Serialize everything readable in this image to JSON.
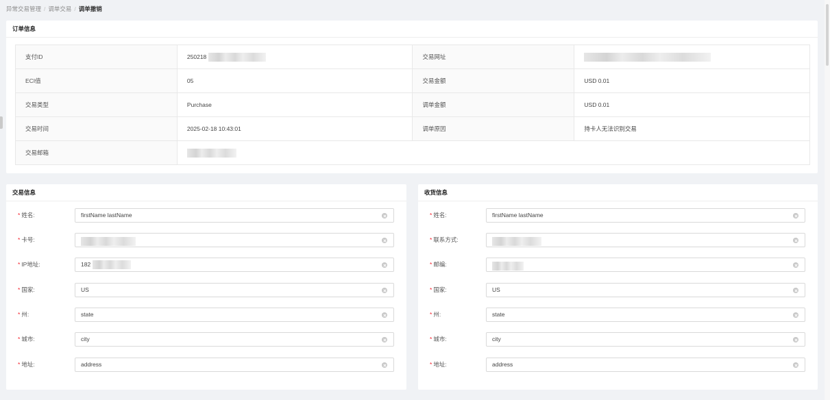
{
  "breadcrumb": {
    "level1": "异常交易管理",
    "sep": "/",
    "level2": "调单交易",
    "current": "调单撤销"
  },
  "order_info": {
    "title": "订单信息",
    "pay_id_label": "支付ID",
    "pay_id_value": "250218",
    "site_label": "交易网址",
    "eci_label": "ECI值",
    "eci_value": "05",
    "amount_label": "交易金额",
    "amount_value": "USD 0.01",
    "type_label": "交易类型",
    "type_value": "Purchase",
    "dispute_amount_label": "调单金额",
    "dispute_amount_value": "USD 0.01",
    "time_label": "交易时间",
    "time_value": "2025-02-18 10:43:01",
    "reason_label": "调单原因",
    "reason_value": "持卡人无法识别交易",
    "email_label": "交易邮箱"
  },
  "transaction_info": {
    "title": "交易信息",
    "fields": [
      {
        "label": "姓名:",
        "value": "firstName lastName"
      },
      {
        "label": "卡号:",
        "value": ""
      },
      {
        "label": "IP地址:",
        "value": "182"
      },
      {
        "label": "国家:",
        "value": "US"
      },
      {
        "label": "州:",
        "value": "state"
      },
      {
        "label": "城市:",
        "value": "city"
      },
      {
        "label": "地址:",
        "value": "address"
      }
    ]
  },
  "shipping_info": {
    "title": "收货信息",
    "fields": [
      {
        "label": "姓名:",
        "value": "firstName lastName"
      },
      {
        "label": "联系方式:",
        "value": ""
      },
      {
        "label": "邮编:",
        "value": ""
      },
      {
        "label": "国家:",
        "value": "US"
      },
      {
        "label": "州:",
        "value": "state"
      },
      {
        "label": "城市:",
        "value": "city"
      },
      {
        "label": "地址:",
        "value": "address"
      }
    ]
  },
  "required_mark": "*",
  "colors": {
    "required": "#f5222d",
    "background": "#f0f2f5",
    "border": "#d9d9d9"
  },
  "icons": {
    "clear": "clear-circle-icon"
  }
}
